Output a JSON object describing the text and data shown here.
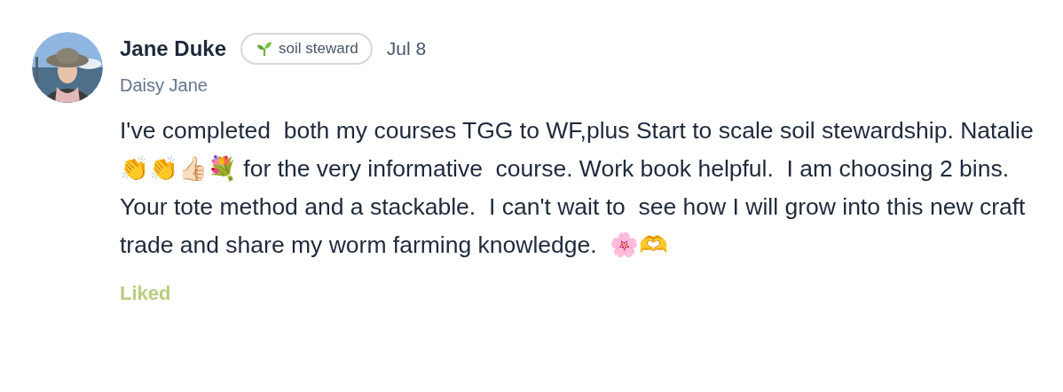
{
  "post": {
    "author": "Jane Duke",
    "badge": "soil steward",
    "date": "Jul 8",
    "display_name": "Daisy Jane",
    "body": "I've completed  both my courses TGG to WF,plus Start to scale soil stewardship. Natalie 👏👏👍🏻💐 for the very informative  course. Work book helpful.  I am choosing 2 bins. Your tote method and a stackable.  I can't wait to  see how I will grow into this new craft trade and share my worm farming knowledge.  🌸🫶",
    "liked": true,
    "like_label": "Liked"
  }
}
